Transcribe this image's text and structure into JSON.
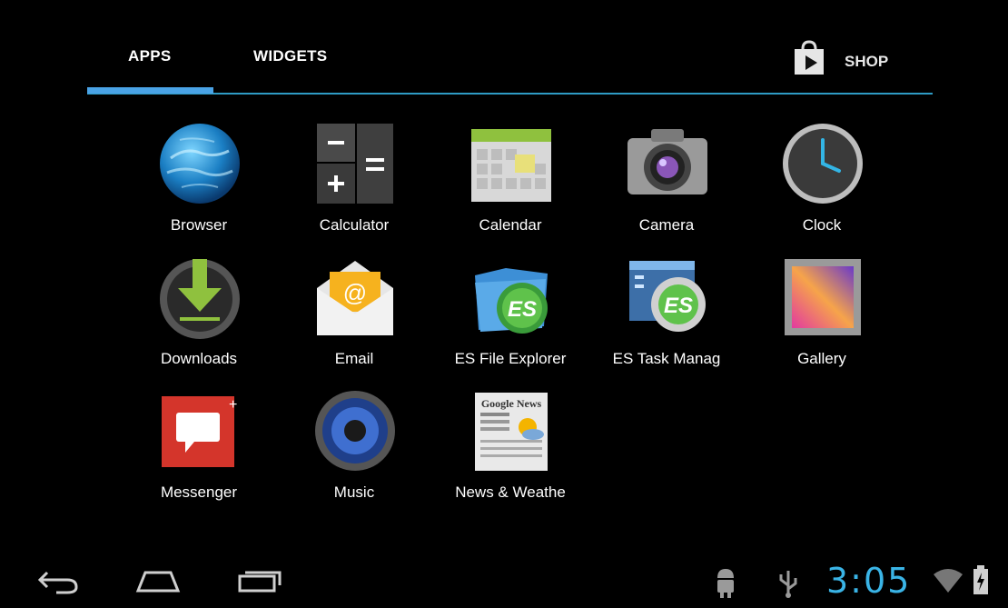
{
  "tabs": {
    "apps": "APPS",
    "widgets": "WIDGETS",
    "shop": "SHOP"
  },
  "apps": [
    {
      "label": "Browser",
      "icon": "browser-globe-icon"
    },
    {
      "label": "Calculator",
      "icon": "calculator-icon"
    },
    {
      "label": "Calendar",
      "icon": "calendar-icon"
    },
    {
      "label": "Camera",
      "icon": "camera-icon"
    },
    {
      "label": "Clock",
      "icon": "clock-icon"
    },
    {
      "label": "Downloads",
      "icon": "downloads-icon"
    },
    {
      "label": "Email",
      "icon": "email-icon"
    },
    {
      "label": "ES File Explorer",
      "icon": "es-file-explorer-icon"
    },
    {
      "label": "ES Task Manag",
      "icon": "es-task-manager-icon"
    },
    {
      "label": "Gallery",
      "icon": "gallery-icon"
    },
    {
      "label": "Messenger",
      "icon": "messenger-icon"
    },
    {
      "label": "Music",
      "icon": "music-icon"
    },
    {
      "label": "News & Weathe",
      "icon": "news-weather-icon"
    }
  ],
  "status": {
    "time": "3:05"
  },
  "colors": {
    "accent": "#33b5e5",
    "tab_indicator": "#4aa3e6",
    "background": "#000000"
  }
}
